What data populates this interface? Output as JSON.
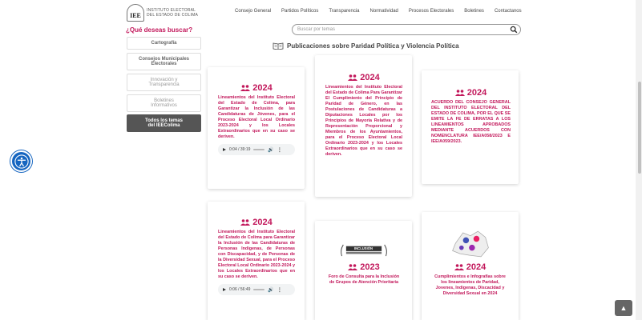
{
  "header": {
    "logo_abbr": "IEE",
    "logo_line1": "INSTITUTO ELECTORAL",
    "logo_line2": "DEL ESTADO DE COLIMA",
    "nav": [
      "Consejo General",
      "Partidos Políticos",
      "Transparencia",
      "Normatividad",
      "Procesos Electorales",
      "Boletines",
      "Contactanos"
    ]
  },
  "search": {
    "prompt": "¿Qué deseas buscar?",
    "placeholder": "Buscar por temas"
  },
  "sidebar": [
    {
      "line1": "Cartografía",
      "line2": ""
    },
    {
      "line1": "Consejos Municipales",
      "line2": "Electorales"
    },
    {
      "line1": "Innovación y",
      "line2": "Transparencia"
    },
    {
      "line1": "Boletines",
      "line2": "Informativos"
    },
    {
      "line1": "Todos los temas",
      "line2": "del IEEColima"
    }
  ],
  "section_title": "Publicaciones sobre Paridad Política y Violencia Política",
  "cards": [
    {
      "year": "2024",
      "text": "Lineamientos del Instituto Electoral del Estado de Colima, para Garantizar la Inclusión de las Candidaturas de Jóvenes, para el Proceso Electoral Local Ordinario 2023-2024 y los Locales Extraordinarios que en su caso se deriven.",
      "audio_time": "0:04 / 39:19"
    },
    {
      "year": "2024",
      "text": "Lineamientos del Instituto Electoral del Estado de Colima Para Garantizar El Cumplimiento del Principio de Paridad de Género, en las Postulaciones de Candidaturas a Diputaciones Locales por los Principios de Mayoría Relativa y de Representación Proporcional y Miembros de los Ayuntamientos, para el Proceso Electoral Local Ordinario 2023-2024 y los Locales Extraordinarios que en su caso se deriven."
    },
    {
      "year": "2024",
      "text": "ACUERDO DEL CONSEJO GENERAL DEL INSTITUTO ELECTORAL DEL ESTADO DE COLIMA, POR EL QUE SE EMITE LA FE DE ERRATAS A LOS LINEAMIENTOS APROBADOS MEDIANTE ACUERDOS CON NOMENCLATURA IEE/A058/2023 E IEE/A059/2023."
    },
    {
      "year": "2024",
      "text": "Lineamientos del Instituto Electoral del Estado de Colima para Garantizar la Inclusión de las Candidaturas de Personas Indígenas, de Personas con Discapacidad, y de Personas de la Diversidad Sexual, para el Proceso Electoral Local Ordinario 2023-2024 y los Locales Extraordinarios que en su caso se deriven.",
      "audio_time": "0:06 / 56:49"
    },
    {
      "year": "2023",
      "badge_text": "INCLUSIÓN",
      "text": "Foro de Consulta para la Inclusión de Grupos de Atención Prioritaria"
    },
    {
      "year": "2024",
      "text": "Cumplimientos e Infografías sobre los lineamientos de Paridad, Jovenes, Indígenas, Discacidad y Diversidad Sexual en 2024"
    }
  ],
  "colors": {
    "accent": "#c2185b",
    "a11y": "#1565c0",
    "active_side": "#555555"
  }
}
